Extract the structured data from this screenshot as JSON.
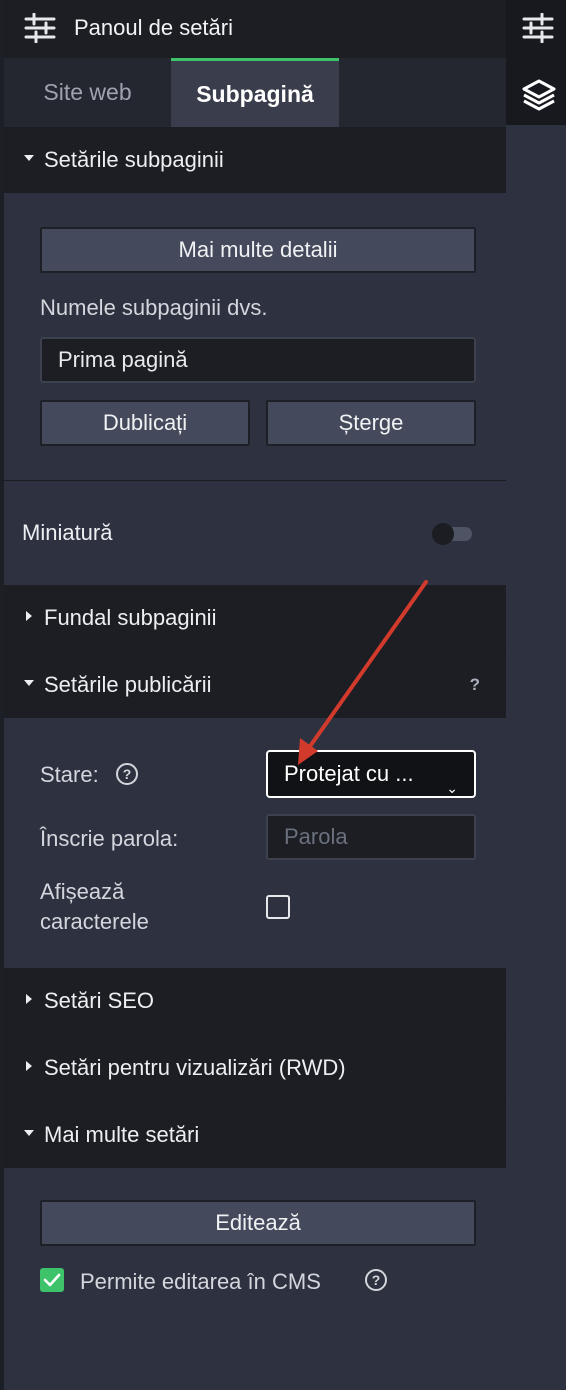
{
  "header": {
    "title": "Panoul de setări"
  },
  "tabs": [
    {
      "label": "Site web"
    },
    {
      "label": "Subpagină"
    }
  ],
  "sections": {
    "subpage_settings": {
      "title": "Setările subpaginii",
      "more_details": "Mai multe detalii",
      "name_label": "Numele subpaginii dvs.",
      "name_value": "Prima pagină",
      "duplicate": "Dublicați",
      "delete": "Șterge"
    },
    "thumbnail": {
      "label": "Miniatură",
      "enabled": false
    },
    "background": {
      "title": "Fundal subpaginii"
    },
    "publish": {
      "title": "Setările publicării",
      "help": "?",
      "status_label": "Stare:",
      "status_value": "Protejat cu ...",
      "password_label": "Înscrie parola:",
      "password_placeholder": "Parola",
      "show_chars_label_1": "Afișează",
      "show_chars_label_2": "caracterele",
      "show_chars_checked": false
    },
    "seo": {
      "title": "Setări SEO"
    },
    "rwd": {
      "title": "Setări pentru vizualizări (RWD)"
    },
    "more": {
      "title": "Mai multe setări",
      "edit": "Editează",
      "allow_cms_label": "Permite editarea în CMS",
      "allow_cms_checked": true
    }
  },
  "icons": {
    "header": "sliders-icon",
    "right_top": "sliders-icon",
    "right_layers": "layers-icon"
  },
  "colors": {
    "accent": "#3ec36b",
    "annotation_arrow": "#d23a2c"
  }
}
